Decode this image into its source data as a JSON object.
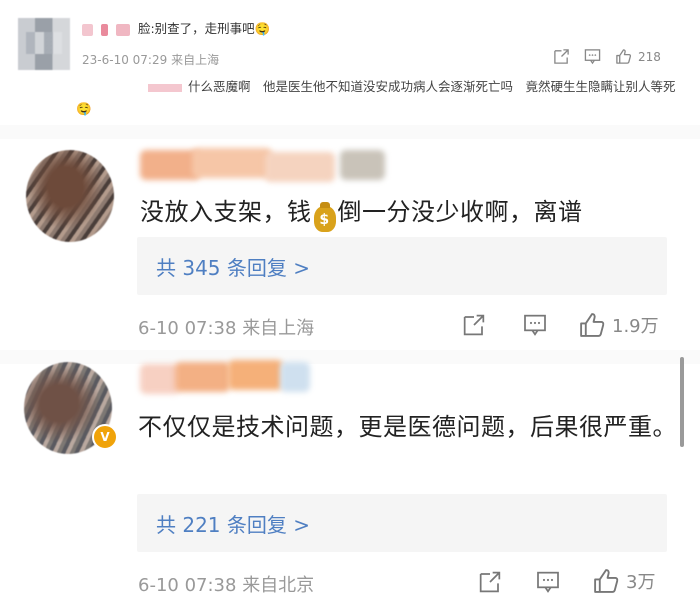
{
  "quoted_comment": {
    "name_visible": "脸",
    "text": ":别查了，走刑事吧",
    "emoji": "🤤",
    "timestamp": "23-6-10 07:29",
    "location": "来自上海",
    "like_count": "218",
    "reply_text": "什么恶魔啊　他是医生他不知道没安成功病人会逐渐死亡吗　竟然硬生生隐瞒让别人等死",
    "reply_emoji": "🤤"
  },
  "comments": [
    {
      "text_part1": "没放入支架，钱",
      "money_icon": "$",
      "text_part2": "倒一分没少收啊，离谱",
      "replies_link": "共 345 条回复 >",
      "timestamp": "6-10 07:38",
      "location": "来自上海",
      "like_count": "1.9万"
    },
    {
      "text": "不仅仅是技术问题，更是医德问题，后果很严重。",
      "verified_badge": "V",
      "replies_link": "共 221 条回复 >",
      "timestamp": "6-10 07:38",
      "location": "来自北京",
      "like_count": "3万"
    }
  ],
  "icons": [
    "share-icon",
    "comment-icon",
    "like-icon",
    "money-bag-icon",
    "verified-badge-icon"
  ],
  "colors": {
    "link": "#4f7fc2",
    "meta": "#999999",
    "reply_bg": "#f5f5f5",
    "badge": "#f0a30a"
  }
}
